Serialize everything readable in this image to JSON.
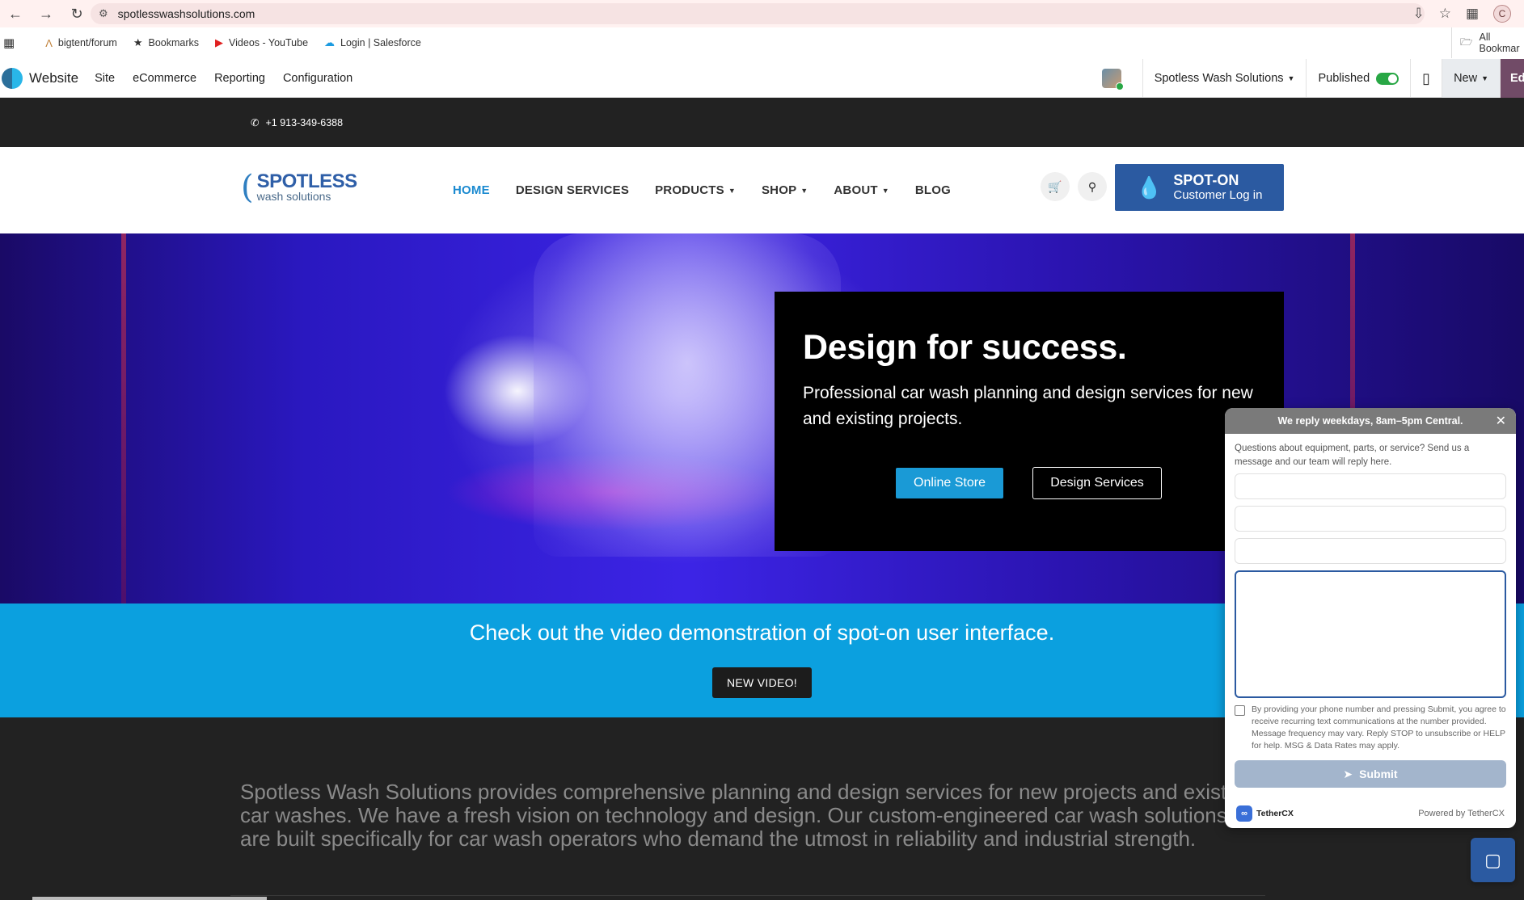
{
  "browser": {
    "url": "spotlesswashsolutions.com",
    "profile_initial": "C",
    "bookmarks": [
      {
        "label": "bigtent/forum",
        "icon": "bigtent-icon"
      },
      {
        "label": "Bookmarks",
        "icon": "star-icon"
      },
      {
        "label": "Videos - YouTube",
        "icon": "youtube-icon"
      },
      {
        "label": "Login | Salesforce",
        "icon": "salesforce-icon"
      }
    ],
    "all_bookmarks": "All Bookmar"
  },
  "editor_bar": {
    "app_title": "Website",
    "menus": [
      "Site",
      "eCommerce",
      "Reporting",
      "Configuration"
    ],
    "company": "Spotless Wash Solutions",
    "published_label": "Published",
    "new_label": "New",
    "edit_label": "Ed"
  },
  "site": {
    "phone": "+1 913-349-6388",
    "brand_top": "SPOTLESS",
    "brand_bottom": "wash solutions",
    "nav": [
      {
        "label": "HOME",
        "active": true,
        "dropdown": false
      },
      {
        "label": "DESIGN SERVICES",
        "active": false,
        "dropdown": false
      },
      {
        "label": "PRODUCTS",
        "active": false,
        "dropdown": true
      },
      {
        "label": "SHOP",
        "active": false,
        "dropdown": true
      },
      {
        "label": "ABOUT",
        "active": false,
        "dropdown": true
      },
      {
        "label": "BLOG",
        "active": false,
        "dropdown": false
      }
    ],
    "spoton_title": "SPOT-ON",
    "spoton_sub": "Customer Log in"
  },
  "hero": {
    "heading": "Design for success.",
    "subtext": "Professional car wash planning and design services for new and existing projects.",
    "btn_store": "Online Store",
    "btn_design": "Design Services"
  },
  "band": {
    "text": "Check out the video demonstration of spot-on user interface.",
    "button": "NEW VIDEO!"
  },
  "about": {
    "paragraph": "Spotless Wash Solutions provides comprehensive planning and design services for new projects and existing car washes. We have a fresh vision on technology and design. Our custom-engineered car wash solutions are built specifically for car wash operators who demand the utmost in reliability and industrial strength."
  },
  "chat": {
    "header": "We reply weekdays, 8am–5pm Central.",
    "intro": "Questions about equipment, parts, or service? Send us a message and our team will reply here.",
    "field_values": [
      "",
      "",
      ""
    ],
    "message_value": "",
    "consent": "By providing your phone number and pressing Submit, you agree to receive recurring text communications at the number provided. Message frequency may vary. Reply STOP to unsubscribe or HELP for help. MSG & Data Rates may apply.",
    "submit": "Submit",
    "brand": "TetherCX",
    "powered": "Powered by TetherCX"
  },
  "colors": {
    "accent_blue": "#0ba0df",
    "brand_blue": "#2b5aa1",
    "odoo_purple": "#714b67",
    "published_green": "#28a745"
  }
}
